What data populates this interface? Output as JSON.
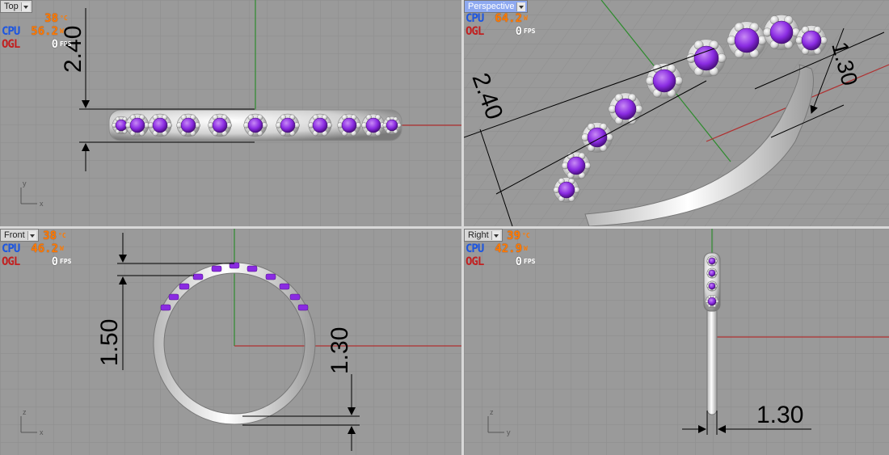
{
  "viewports": {
    "top": {
      "tab_label": "Top",
      "stats": {
        "temp": "38",
        "temp_unit": "°C",
        "cpu_label": "CPU",
        "cpu_value": "56.2",
        "cpu_unit": "W",
        "ogl_label": "OGL",
        "ogl_value": "0",
        "ogl_unit": "FPS"
      },
      "dimension": "2.40",
      "axis_x": "x",
      "axis_y": "y"
    },
    "perspective": {
      "tab_label": "Perspective",
      "stats": {
        "temp": "",
        "temp_unit": "°C",
        "cpu_label": "CPU",
        "cpu_value": "64.2",
        "cpu_unit": "W",
        "ogl_label": "OGL",
        "ogl_value": "0",
        "ogl_unit": "FPS"
      },
      "dimension_a": "2.40",
      "dimension_b": "1.30"
    },
    "front": {
      "tab_label": "Front",
      "stats": {
        "temp": "38",
        "temp_unit": "°C",
        "cpu_label": "CPU",
        "cpu_value": "46.2",
        "cpu_unit": "W",
        "ogl_label": "OGL",
        "ogl_value": "0",
        "ogl_unit": "FPS"
      },
      "dimension_a": "1.50",
      "dimension_b": "1.30",
      "axis_x": "x",
      "axis_z": "z"
    },
    "right": {
      "tab_label": "Right",
      "stats": {
        "temp": "39",
        "temp_unit": "°C",
        "cpu_label": "CPU",
        "cpu_value": "42.9",
        "cpu_unit": "W",
        "ogl_label": "OGL",
        "ogl_value": "0",
        "ogl_unit": "FPS"
      },
      "dimension": "1.30",
      "axis_y": "y",
      "axis_z": "z"
    }
  },
  "colors": {
    "background": "#9a9a9a",
    "grid": "#8a8a8a",
    "axis_x": "#b03030",
    "axis_y": "#2e8b2e",
    "stone": "#8a2be2",
    "metal": "#e6e6e6"
  }
}
